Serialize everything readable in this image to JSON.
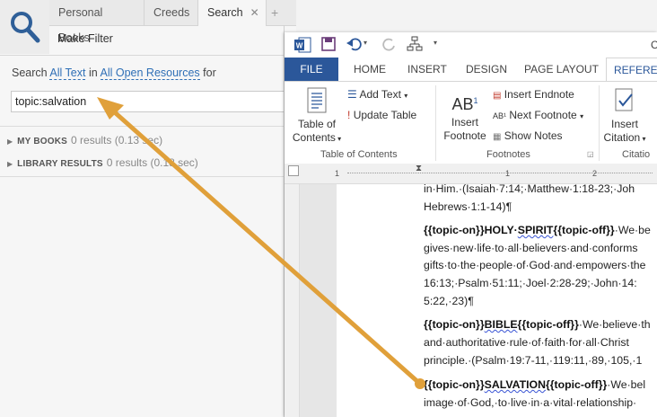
{
  "logos": {
    "tabs": [
      {
        "label": "Personal Books"
      },
      {
        "label": "Creeds"
      },
      {
        "label": "Search",
        "close": "✕"
      }
    ],
    "add_tab": "+",
    "make_filter": "Make Filter",
    "search_prefix": "Search",
    "scope_link": "All Text",
    "in_word": "in",
    "resources_link": "All Open Resources",
    "for_word": "for",
    "query": "topic:salvation",
    "results": [
      {
        "label": "MY BOOKS",
        "count": "0 results (0.13 sec)"
      },
      {
        "label": "LIBRARY RESULTS",
        "count": "0 results (0.18 sec)"
      }
    ]
  },
  "word": {
    "title_fragment": "C",
    "ribbon_tabs": [
      "FILE",
      "HOME",
      "INSERT",
      "DESIGN",
      "PAGE LAYOUT",
      "REFEREN"
    ],
    "toc": {
      "label_line1": "Table of",
      "label_line2": "Contents",
      "group": "Table of Contents",
      "add_text": "Add Text",
      "update_table": "Update Table"
    },
    "footnotes": {
      "insert_line1": "Insert",
      "insert_line2": "Footnote",
      "insert_endnote": "Insert Endnote",
      "next_footnote": "Next Footnote",
      "show_notes": "Show Notes",
      "group": "Footnotes"
    },
    "citations": {
      "insert_line1": "Insert",
      "insert_line2": "Citation",
      "group": "Citatio"
    },
    "ruler_marks": [
      "1",
      "1",
      "2"
    ],
    "document": [
      {
        "tokens": [
          {
            "t": "in·Him.·(Isaiah·7:14;·Matthew·1:18-23;·Joh"
          }
        ]
      },
      {
        "tokens": [
          {
            "t": "Hebrews·1:1-14)¶"
          }
        ]
      },
      {
        "tokens": [
          {
            "t": "{{topic-on}}HOLY·",
            "b": true
          },
          {
            "t": "SPIRIT",
            "b": true,
            "sq": true
          },
          {
            "t": "{{topic-off}}",
            "b": true
          },
          {
            "t": "·We·be"
          }
        ]
      },
      {
        "tokens": [
          {
            "t": "gives·new·life·to·all·believers·and·conforms"
          }
        ]
      },
      {
        "tokens": [
          {
            "t": "gifts·to·the·people·of·God·and·empowers·the"
          }
        ]
      },
      {
        "tokens": [
          {
            "t": "16:13;·Psalm·51:11;·Joel·2:28-29;·John·14:"
          }
        ]
      },
      {
        "tokens": [
          {
            "t": "5:22,·23)¶"
          }
        ]
      },
      {
        "tokens": [
          {
            "t": "{{topic-on}}",
            "b": true
          },
          {
            "t": "BIBLE",
            "b": true,
            "sq": true
          },
          {
            "t": "{{topic-off}}",
            "b": true
          },
          {
            "t": "·We·believe·th"
          }
        ]
      },
      {
        "tokens": [
          {
            "t": "and·authoritative·rule·of·faith·for·all·Christ"
          }
        ]
      },
      {
        "tokens": [
          {
            "t": "principle.·(Psalm·19:7-11,·119:11,·89,·105,·1"
          }
        ]
      },
      {
        "tokens": [
          {
            "t": "{{topic-on}}",
            "b": true
          },
          {
            "t": "SALVATION",
            "b": true,
            "sq": true
          },
          {
            "t": "{{topic-off}}",
            "b": true
          },
          {
            "t": "·We·bel"
          }
        ]
      },
      {
        "tokens": [
          {
            "t": "image·of·God,·to·live·in·a·vital·relationship·"
          }
        ]
      }
    ]
  },
  "colors": {
    "word_blue": "#2b579a",
    "link_blue": "#2f6fb6",
    "arrow": "#e0a03a"
  }
}
